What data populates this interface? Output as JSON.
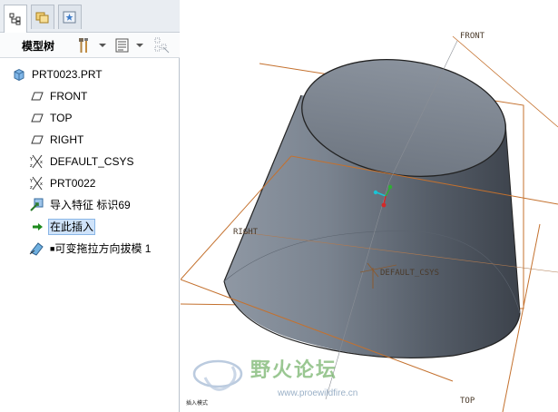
{
  "model_tree": {
    "title": "模型树",
    "tabs": [
      {
        "icon": "model-tree-tab-icon"
      },
      {
        "icon": "folder-browser-tab-icon"
      },
      {
        "icon": "favorites-tab-icon"
      }
    ],
    "toolbar": [
      {
        "icon": "settings-hammer-icon"
      },
      {
        "icon": "show-tree-filter-icon"
      },
      {
        "icon": "display-columns-icon"
      }
    ],
    "items": [
      {
        "label": "PRT0023.PRT",
        "icon": "part-icon"
      },
      {
        "label": "FRONT",
        "icon": "datum-plane-icon"
      },
      {
        "label": "TOP",
        "icon": "datum-plane-icon"
      },
      {
        "label": "RIGHT",
        "icon": "datum-plane-icon"
      },
      {
        "label": "DEFAULT_CSYS",
        "icon": "coordinate-system-icon"
      },
      {
        "label": "PRT0022",
        "icon": "coordinate-system-icon"
      },
      {
        "label": "导入特征 标识69",
        "icon": "import-feature-icon"
      },
      {
        "label": "在此插入",
        "icon": "insert-here-arrow-icon",
        "selected": true
      },
      {
        "label": "可变拖拉方向拔模 1",
        "icon": "variable-draft-icon"
      }
    ]
  },
  "graphics": {
    "plane_labels": {
      "front": "FRONT",
      "right": "RIGHT",
      "csys": "DEFAULT_CSYS",
      "top": "TOP"
    },
    "status_text": "插入模式"
  },
  "watermark": {
    "title": "野火论坛",
    "url": "www.proewildfire.cn"
  },
  "colors": {
    "datum_plane": "#c4712e",
    "model_surface": "#7e8794",
    "selection_highlight": "#cfe3fa"
  }
}
